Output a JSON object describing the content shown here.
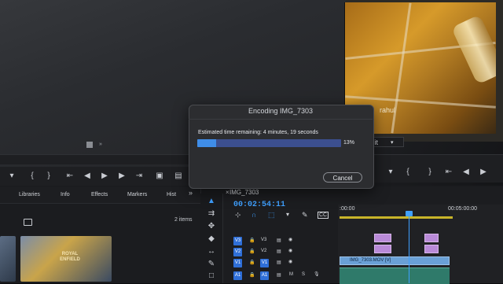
{
  "dialog": {
    "title": "Encoding IMG_7303",
    "eta_label": "Estimated time remaining: 4 minutes, 19 seconds",
    "progress_percent": 13,
    "progress_text": "13%",
    "cancel_label": "Cancel"
  },
  "program_monitor": {
    "overlay_text": "rahul",
    "scale_value": "Fit"
  },
  "project_panel": {
    "tabs": [
      "Libraries",
      "Info",
      "Effects",
      "Markers",
      "Hist"
    ],
    "more_glyph": "»",
    "items_count": "2 items",
    "thumbnail_text": "ROYAL ENFIELD"
  },
  "timeline": {
    "sequence_name": "IMG_7303",
    "timecode": "00:02:54:11",
    "ruler_start": ":00:00",
    "ruler_end": "00:05:00:00",
    "tracks": [
      {
        "toggle": "V3",
        "name": "V3"
      },
      {
        "toggle": "V2",
        "name": "V2"
      },
      {
        "toggle": "V1",
        "name": "V1"
      },
      {
        "toggle": "A1",
        "name": "A1"
      }
    ],
    "audio_controls": [
      "M",
      "S"
    ],
    "clip_label": "IMG_7303.MOV [V]"
  },
  "colors": {
    "accent_blue": "#3fa0ff",
    "progress_fill": "#3f8de8",
    "video_clip": "#6aa0d6",
    "graphic_clip": "#b98ad8",
    "audio_clip": "#2f7a6a"
  }
}
